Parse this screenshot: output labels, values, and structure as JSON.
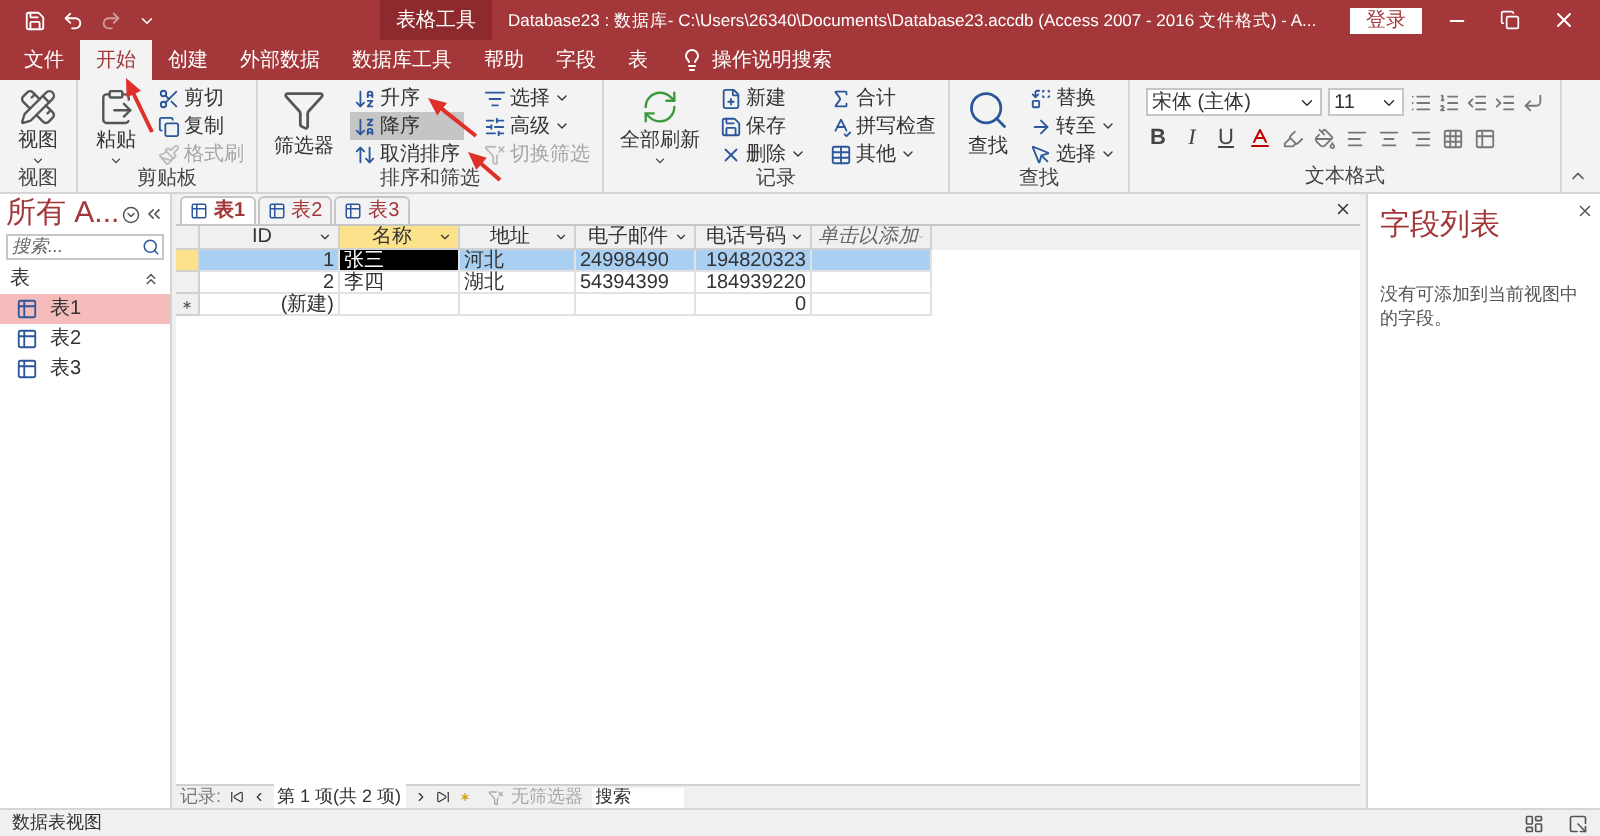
{
  "title_bar": {
    "context_label": "表格工具",
    "title": "Database23 : 数据库- C:\\Users\\26340\\Documents\\Database23.accdb (Access 2007 - 2016 文件格式)  -  A...",
    "sign_in": "登录"
  },
  "tabs": [
    {
      "label": "文件",
      "selected": false
    },
    {
      "label": "开始",
      "selected": true
    },
    {
      "label": "创建",
      "selected": false
    },
    {
      "label": "外部数据",
      "selected": false
    },
    {
      "label": "数据库工具",
      "selected": false
    },
    {
      "label": "帮助",
      "selected": false
    },
    {
      "label": "字段",
      "selected": false
    },
    {
      "label": "表",
      "selected": false
    }
  ],
  "tell_me": "操作说明搜索",
  "ribbon": {
    "groups": [
      {
        "kind": "commands",
        "label": "视图",
        "commands": [
          {
            "label": "视图",
            "kind": "large",
            "menu": true,
            "disabled": false,
            "pressed": false
          }
        ]
      },
      {
        "kind": "commands",
        "label": "剪贴板",
        "commands": [
          {
            "label": "粘贴",
            "kind": "large",
            "menu": true,
            "disabled": false,
            "pressed": false
          },
          {
            "label": "剪切",
            "kind": "small",
            "menu": false,
            "disabled": false,
            "pressed": false
          },
          {
            "label": "复制",
            "kind": "small",
            "menu": false,
            "disabled": false,
            "pressed": false
          },
          {
            "label": "格式刷",
            "kind": "small",
            "menu": false,
            "disabled": true,
            "pressed": false
          }
        ]
      },
      {
        "kind": "commands",
        "label": "排序和筛选",
        "commands": [
          {
            "label": "筛选器",
            "kind": "large",
            "menu": false,
            "disabled": false,
            "pressed": false
          },
          {
            "label": "升序",
            "kind": "small",
            "menu": false,
            "disabled": false,
            "pressed": false
          },
          {
            "label": "降序",
            "kind": "small",
            "menu": false,
            "disabled": false,
            "pressed": true
          },
          {
            "label": "取消排序",
            "kind": "small",
            "menu": false,
            "disabled": false,
            "pressed": false
          },
          {
            "label": "选择",
            "kind": "small",
            "menu": true,
            "disabled": false,
            "pressed": false
          },
          {
            "label": "高级",
            "kind": "small",
            "menu": true,
            "disabled": false,
            "pressed": false
          },
          {
            "label": "切换筛选",
            "kind": "small",
            "menu": false,
            "disabled": true,
            "pressed": false
          }
        ]
      },
      {
        "kind": "commands",
        "label": "记录",
        "commands": [
          {
            "label": "全部刷新",
            "kind": "large",
            "menu": true,
            "disabled": false,
            "pressed": false
          },
          {
            "label": "新建",
            "kind": "small",
            "menu": false,
            "disabled": false,
            "pressed": false
          },
          {
            "label": "保存",
            "kind": "small",
            "menu": false,
            "disabled": false,
            "pressed": false
          },
          {
            "label": "删除",
            "kind": "small",
            "menu": true,
            "disabled": false,
            "pressed": false
          },
          {
            "label": "合计",
            "kind": "small",
            "menu": false,
            "disabled": false,
            "pressed": false
          },
          {
            "label": "拼写检查",
            "kind": "small",
            "menu": false,
            "disabled": false,
            "pressed": false
          },
          {
            "label": "其他",
            "kind": "small",
            "menu": true,
            "disabled": false,
            "pressed": false
          }
        ]
      },
      {
        "kind": "commands",
        "label": "查找",
        "commands": [
          {
            "label": "查找",
            "kind": "large",
            "menu": false,
            "disabled": false,
            "pressed": false
          },
          {
            "label": "替换",
            "kind": "small",
            "menu": false,
            "disabled": false,
            "pressed": false
          },
          {
            "label": "转至",
            "kind": "small",
            "menu": true,
            "disabled": false,
            "pressed": false
          },
          {
            "label": "选择",
            "kind": "small",
            "menu": true,
            "disabled": false,
            "pressed": false
          }
        ]
      },
      {
        "kind": "text_format",
        "label": "文本格式",
        "font": "宋体 (主体)",
        "size": "11",
        "format_buttons": [
          "B",
          "I",
          "U"
        ]
      }
    ]
  },
  "nav_pane": {
    "title": "所有 A...",
    "search": {
      "placeholder": "搜索..."
    },
    "section": "表",
    "items": [
      {
        "label": "表1",
        "selected": true
      },
      {
        "label": "表2",
        "selected": false
      },
      {
        "label": "表3",
        "selected": false
      }
    ]
  },
  "document_tabs": [
    {
      "label": "表1",
      "selected": true
    },
    {
      "label": "表2",
      "selected": false
    },
    {
      "label": "表3",
      "selected": false
    }
  ],
  "table": {
    "columns": [
      {
        "label": "ID",
        "kind": "field",
        "selected": false
      },
      {
        "label": "名称",
        "kind": "field",
        "selected": true
      },
      {
        "label": "地址",
        "kind": "field",
        "selected": false
      },
      {
        "label": "电子邮件",
        "kind": "field",
        "selected": false
      },
      {
        "label": "电话号码",
        "kind": "field",
        "selected": false
      },
      {
        "label": "单击以添加",
        "kind": "add",
        "selected": false
      }
    ],
    "rows": [
      {
        "kind": "record",
        "selected": true,
        "cells": [
          {
            "text": "1",
            "selected": false
          },
          {
            "text": "张三",
            "selected": true
          },
          {
            "text": "河北",
            "selected": false
          },
          {
            "text": "24998490",
            "selected": false
          },
          {
            "text": "194820323",
            "selected": false
          },
          {
            "selected": false
          }
        ]
      },
      {
        "kind": "record",
        "selected": false,
        "cells": [
          {
            "text": "2",
            "selected": false
          },
          {
            "text": "李四",
            "selected": false
          },
          {
            "text": "湖北",
            "selected": false
          },
          {
            "text": "54394399",
            "selected": false
          },
          {
            "text": "184939220",
            "selected": false
          },
          {
            "selected": false
          }
        ]
      },
      {
        "kind": "new",
        "selected": false,
        "cells": [
          {
            "text": "(新建)",
            "selected": false
          },
          {
            "selected": false
          },
          {
            "selected": false
          },
          {
            "selected": false
          },
          {
            "text": "0",
            "selected": false
          },
          {
            "selected": false
          }
        ]
      }
    ]
  },
  "record_nav": {
    "label": "记录:",
    "position": "第 1 项(共 2 项)",
    "filter": "无筛选器",
    "search": {
      "placeholder": "搜索"
    }
  },
  "field_list": {
    "title": "字段列表",
    "message": "没有可添加到当前视图中的字段。"
  },
  "status_bar": {
    "text": "数据表视图"
  }
}
